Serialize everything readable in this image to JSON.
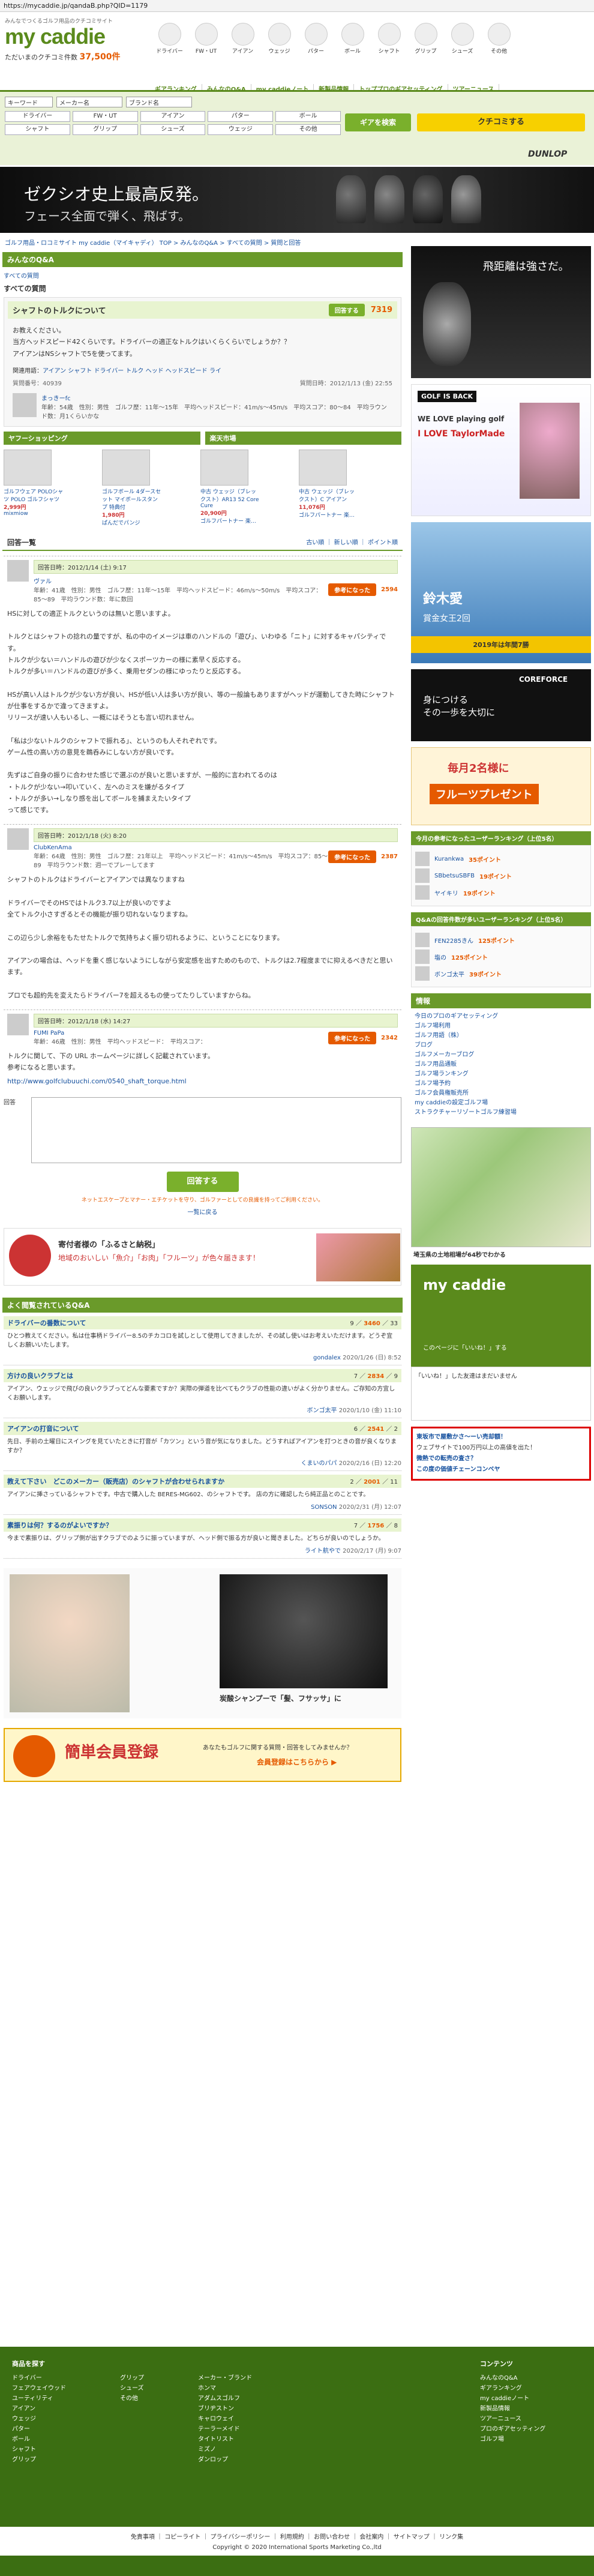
{
  "url": "https://mycaddie.jp/qandaB.php?QID=1179",
  "header": {
    "tagline": "みんなでつくるゴルフ用品のクチコミサイト",
    "logo": "my caddie",
    "sub_prefix": "ただいまのクチコミ件数",
    "count": "37,500件",
    "categories": [
      "ドライバー",
      "FW・UT",
      "アイアン",
      "ウェッジ",
      "パター",
      "ボール",
      "シャフト",
      "グリップ",
      "シューズ",
      "その他"
    ],
    "nav": [
      "ギアランキング",
      "みんなのQ&A",
      "my caddieノート",
      "新製品情報",
      "トッププロのギアセッティング",
      "ツアーニュース"
    ]
  },
  "search": {
    "keyword": "キーワード",
    "maker": "メーカー名",
    "brand": "ブランド名",
    "grid": [
      "ドライバー",
      "FW・UT",
      "アイアン",
      "パター",
      "ボール",
      "シャフト",
      "グリップ",
      "シューズ",
      "ウェッジ",
      "その他"
    ],
    "search_btn": "ギアを検索",
    "review_btn": "クチコミする",
    "dunlop": "DUNLOP"
  },
  "banner": {
    "line1": "ゼクシオ史上最高反発。",
    "line2": "フェース全面で弾く、飛ばす。"
  },
  "breadcrumb": "ゴルフ用品・ロコミサイト my caddie（マイキャディ） TOP > みんなのQ&A > すべての質問 > 質問と回答",
  "qa": {
    "section": "みんなのQ&A",
    "tabs_label": "すべての質問",
    "title": "シャフトのトルクについて",
    "answer_btn": "回答する",
    "views": "7319",
    "body": "お教えください。\n当方ヘッドスピード42くらいです。ドライバーの適正なトルクはいくらくらいでしょうか？？\nアイアンはNSシャフトで5を使ってます。",
    "related_label": "関連用語：",
    "related": "アイアン シャフト ドライバー トルク ヘッド ヘッドスピード ライ",
    "qid": "質問番号：40939",
    "date": "質問日時：2012/1/13 (金) 22:55",
    "user": "まっきーfc",
    "profile": "年齢：54歳　性別：男性　ゴルフ歴：11年〜15年　平均ヘッドスピード：41m/s〜45m/s　平均スコア：80〜84　平均ラウンド数：月1くらいかな"
  },
  "shopping": {
    "yahoo": "ヤフーショッピング",
    "rakuten": "楽天市場",
    "items": [
      {
        "name": "ゴルフウェア POLOシャツ POLO ゴルフシャツ",
        "price": "2,999円",
        "shop": "mixmiow"
      },
      {
        "name": "ゴルフボール 4ダースセット マイボールスタンプ 特典付",
        "price": "1,980円",
        "shop": "ぱんだでパンジ"
      },
      {
        "name": "中古 ウェッジ（ブレックスト）AR13 52 Core Cure",
        "price": "20,900円",
        "shop": "ゴルフパートナー 楽…"
      },
      {
        "name": "中古 ウェッジ（ブレックスト）C アイアン",
        "price": "11,076円",
        "shop": "ゴルフパートナー 楽…"
      }
    ]
  },
  "answers_header": {
    "title": "回答一覧",
    "sort": "古い順 ｜ 新しい順 ｜ ポイント順"
  },
  "answers": [
    {
      "date": "回答日時：2012/1/14 (土) 9:17",
      "user": "ヴァル",
      "profile": "年齢：41歳　性別：男性　ゴルフ歴：11年〜15年　平均ヘッドスピード：46m/s〜50m/s　平均スコア：85〜89　平均ラウンド数：年に数回",
      "agree": "参考になった",
      "points": "2594",
      "body": "HSに対しての適正トルクというのは無いと思いますよ。\n\nトルクとはシャフトの捻れの量ですが、私の中のイメージは車のハンドルの「遊び」、いわゆる「ニト」に対するキャパシティです。\nトルクが少ない＝ハンドルの遊びが少なくスポーツカーの様に素早く反応する。\nトルクが多い＝ハンドルの遊びが多く、乗用セダンの様にゆったりと反応する。\n\nHSが高い人はトルクが少ない方が良い、HSが低い人は多い方が良い、等の一般論もありますがヘッドが運動してきた時にシャフトが仕事をするかで違ってきますよ。\nリリースが速い人もいるし、一概にはそうとも言い切れません。\n\n「私は少ないトルクのシャフトで振れる」、というのも人それぞれです。\nゲーム性の高い方の意見を鵜呑みにしない方が良いです。\n\n先ずはご自身の振りに合わせた感じで選ぶのが良いと思いますが、一般的に言われてるのは\n・トルクが少ない→叩いていく、左へのミスを嫌がるタイプ\n・トルクが多い→しなり感を出してボールを捕まえたいタイプ\nって感じです。"
    },
    {
      "date": "回答日時：2012/1/18 (火) 8:20",
      "user": "ClubKenAma",
      "profile": "年齢：64歳　性別：男性　ゴルフ歴：21年以上　平均ヘッドスピード：41m/s〜45m/s　平均スコア：85〜89　平均ラウンド数：週一でプレーしてます",
      "agree": "参考になった",
      "points": "2387",
      "body": "シャフトのトルクはドライバーとアイアンでは異なりますね\n\nドライバーでそのHSではトルク3.7以上が良いのですよ\n全てトルク小さすぎるとその機能が振り切れないなりますね。\n\nこの辺ら少し余裕をもたせたトルクで気持ちよく振り切れるように、ということになります。\n\nアイアンの場合は、ヘッドを重く感じないようにしながら安定感を出すためのもので、トルクは2.7程度までに抑えるべきだと思います。\n\nプロでも超約先を変えたらドライバー7を超えるもの使ってたりしていますからね。"
    },
    {
      "date": "回答日時：2012/1/18 (水) 14:27",
      "user": "FUMI PaPa",
      "profile": "年齢：46歳　性別：男性　平均ヘッドスピード：　平均スコア：",
      "agree": "参考になった",
      "points": "2342",
      "body": "トルクに関して、下の URL ホームページに詳しく記載されています。\n参考になると思います。",
      "link": "http://www.golfclubuuchi.com/0540_shaft_torque.html"
    }
  ],
  "reply": {
    "label": "回答",
    "submit": "回答する",
    "note": "ネットエスケープとマナー・エチケットを守り、ゴルファーとしての良識を持ってご利用ください。",
    "back": "一覧に戻る"
  },
  "furusato": {
    "line1": "寄付者様の「ふるさと納税」",
    "line2": "地域のおいしい「魚介」「お肉」「フルーツ」が色々届きます！"
  },
  "related_qa": {
    "title": "よく閲覧されているQ&A",
    "items": [
      {
        "title": "ドライバーの番数について",
        "q": "9",
        "views": "3460",
        "pts": "33",
        "body": "ひとつ教えてください。私は仕事柄ドライバー8.5のチカコロを試しとして使用してきましたが、その試し使いはお考えいただけます。どうぞ宜しくお願いいたします。",
        "user": "gondalex",
        "date": "2020/1/26 (日) 8:52"
      },
      {
        "title": "方けの良いクラブとは",
        "q": "7",
        "views": "2834",
        "pts": "9",
        "body": "アイアン、ウェッジで飛びの良いクラブってどんな要素ですか？実際の弾道を比べてもクラブの性能の違いがよく分かりません。ご存知の方宜しくお願いします。",
        "user": "ボンゴ太平",
        "date": "2020/1/10 (金) 11:10"
      },
      {
        "title": "アイアンの打音について",
        "q": "6",
        "views": "2541",
        "pts": "2",
        "body": "先日、手前の土曜日にスイングを見ていたときに打音が「カツン」という音が気になりました。どうすればアイアンを打つときの音が良くなりますか？",
        "user": "くまいのパパ",
        "date": "2020/2/16 (日) 12:20"
      },
      {
        "title": "教えて下さい　どこのメーカー（販売店）のシャフトが合わせられますか",
        "q": "2",
        "views": "2001",
        "pts": "11",
        "body": "アイアンに挿さっているシャフトです。中古で購入した BERES-MG602、のシャフトです。 店の方に確認したら純正品とのことです。",
        "user": "SONSON",
        "date": "2020/2/31 (月) 12:07"
      },
      {
        "title": "素振りは何？するのがよいですか？",
        "q": "7",
        "views": "1756",
        "pts": "8",
        "body": "今まで素振りは、グリップ側が出すクラブでのように振っていますが、ヘッド側で振る方が良いと聞きました。どちらが良いのでしょうか。",
        "user": "ライト航やで",
        "date": "2020/2/17 (月) 9:07"
      }
    ]
  },
  "promo": {
    "text": "炭酸シャンプーで「髪、フサッサ」に"
  },
  "signup": {
    "title": "簡単会員登録",
    "sub": "あなたもゴルフに関する質問・回答をしてみませんか？",
    "sub2": "会員登録はこちらから ▶"
  },
  "sidebar": {
    "ad_catch": "飛距離は強さだ。",
    "golf_back": "GOLF IS BACK",
    "playing": "WE LOVE playing golf",
    "taylormade": "I LOVE TaylorMade",
    "player": "鈴木愛",
    "award": "賞金女王2回",
    "year": "2019年は年間7勝",
    "corefore": "COREFORCE",
    "corefore_sub": "身につける\nその一歩を大切に",
    "present_title": "毎月2名様に",
    "present": "フルーツプレゼント",
    "ranking1_title": "今月の参考になったユーザーランキング（上位5名）",
    "ranking1": [
      {
        "name": "Kurankwa",
        "pts": "35ポイント"
      },
      {
        "name": "SBbetsuSBFB",
        "pts": "19ポイント"
      },
      {
        "name": "ヤイキリ",
        "pts": "19ポイント"
      }
    ],
    "ranking2_title": "Q&Aの回答件数が多いユーザーランキング（上位5名）",
    "ranking2": [
      {
        "name": "FEN2285きん",
        "pts": "125ポイント"
      },
      {
        "name": "塩の",
        "pts": "125ポイント"
      },
      {
        "name": "ボンゴ太平",
        "pts": "39ポイント"
      }
    ],
    "links_title": "情報",
    "links": [
      "今日のプロのギアセッティング",
      "ゴルフ場利用",
      "ゴルフ用語（株）",
      "ブログ",
      "ゴルフメーカーブログ",
      "ゴルフ用品通販",
      "ゴルフ場ランキング",
      "ゴルフ場予約",
      "ゴルフ会員権販売所",
      "my caddieの設定ゴルフ場",
      "ストラクチャーリゾートゴルフ練習場"
    ],
    "map_caption": "埼玉県の土地相場が64秒でわかる",
    "follow": "このページに「いいね！」する",
    "like_text": "「いいね！」した友達はまだいません",
    "redbox1": "東坂市で屋敷かさ〜ーい売却額！",
    "redbox2": "ウェブサイトで100万円以上の高値を出た！",
    "redbox3": "微熱での転売の査さ？",
    "redbox4": "この度の価値チェーンコンベヤ"
  },
  "footer": {
    "col1_title": "商品を探す",
    "col1": [
      "ドライバー",
      "フェアウェイウッド",
      "ユーティリティ",
      "アイアン",
      "ウェッジ",
      "パター",
      "ボール",
      "シャフト",
      "グリップ"
    ],
    "col2": [
      "グリップ",
      "シューズ",
      "その他"
    ],
    "col3": [
      "メーカー・ブランド",
      "ホンマ",
      "アダムスゴルフ",
      "ブリヂストン",
      "キャロウェイ",
      "テーラーメイド",
      "タイトリスト",
      "ミズノ",
      "ダンロップ"
    ],
    "col4_title": "コンテンツ",
    "col4": [
      "みんなのQ&A",
      "ギアランキング",
      "my caddieノート",
      "新製品情報",
      "ツアーニュース",
      "プロのギアセッティング",
      "ゴルフ場"
    ],
    "links": "免責事項 ｜ コピーライト ｜ プライバシーポリシー ｜ 利用規約 ｜ お問い合わせ ｜ 会社案内 ｜ サイトマップ ｜ リンク集",
    "copyright": "Copyright © 2020 International Sports Marketing Co.,ltd"
  },
  "colors": {
    "green": "#5a8a1c",
    "orange": "#e55a00",
    "footer": "#3b6e12"
  }
}
